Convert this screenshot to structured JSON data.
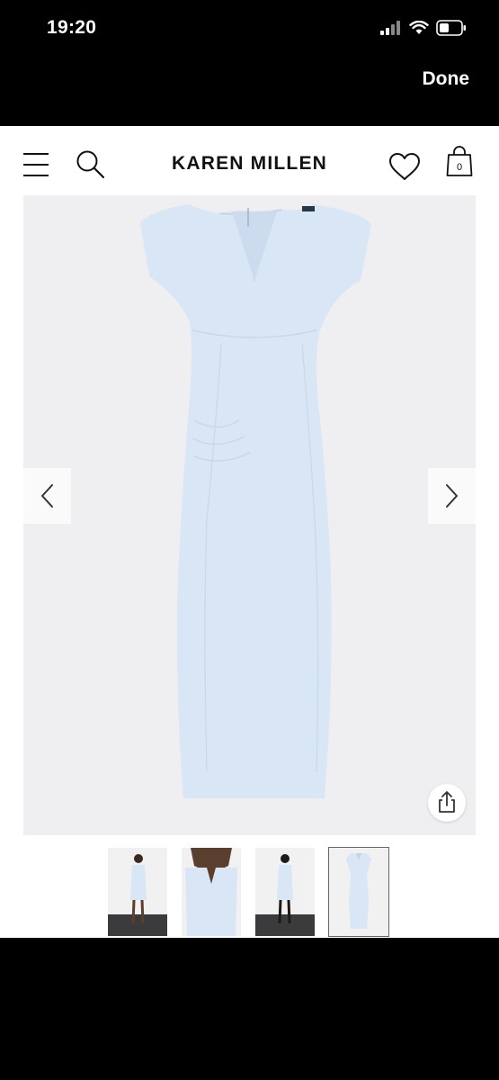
{
  "status_bar": {
    "time": "19:20",
    "icons": [
      "signal-icon",
      "wifi-icon",
      "battery-icon"
    ]
  },
  "browser": {
    "done_label": "Done"
  },
  "header": {
    "brand": "KAREN MILLEN",
    "cart_count": "0",
    "icons": [
      "menu-icon",
      "search-icon",
      "heart-icon",
      "shopping-bag-icon"
    ]
  },
  "product": {
    "image": "light blue sleeveless pencil dress",
    "thumbnails": [
      {
        "label": "model front full length",
        "selected": false
      },
      {
        "label": "model close-up neckline",
        "selected": false
      },
      {
        "label": "model back full length",
        "selected": false
      },
      {
        "label": "dress product shot",
        "selected": true
      }
    ],
    "arrows": [
      "chevron-left-icon",
      "chevron-right-icon"
    ]
  },
  "colors": {
    "dress": "#d9e6f5",
    "gallery_bg": "#efeff1",
    "chrome": "#000000"
  }
}
